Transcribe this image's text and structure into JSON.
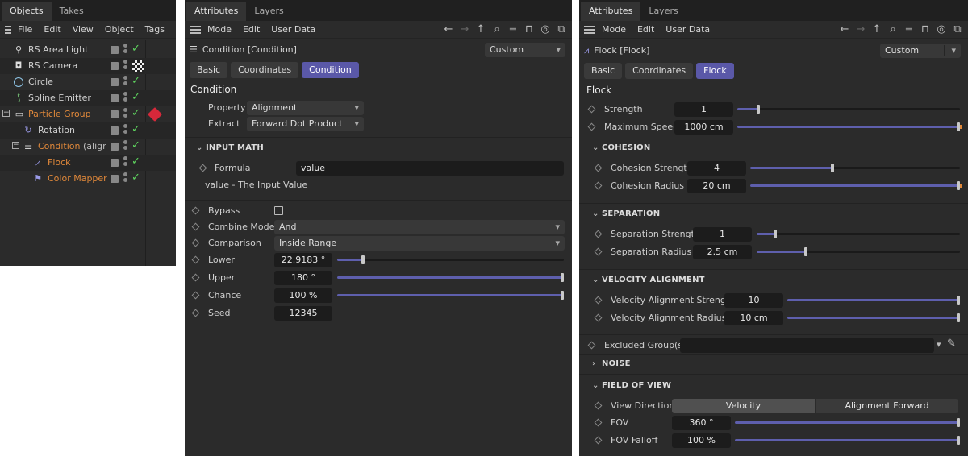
{
  "objects_panel": {
    "tabs": [
      "Objects",
      "Takes"
    ],
    "menus": [
      "File",
      "Edit",
      "View",
      "Object",
      "Tags"
    ],
    "rows": [
      {
        "name": "RS Area Light",
        "icon": "light-icon",
        "color": "normal"
      },
      {
        "name": "RS Camera",
        "icon": "camera-icon",
        "color": "normal"
      },
      {
        "name": "Circle",
        "icon": "circle-icon",
        "color": "normal"
      },
      {
        "name": "Spline Emitter",
        "icon": "spline-emitter-icon",
        "color": "normal"
      },
      {
        "name": "Particle Group",
        "icon": "folder-icon",
        "color": "orange"
      },
      {
        "name": "Rotation",
        "icon": "rotation-icon",
        "color": "normal"
      },
      {
        "name": "Condition",
        "suffix": "(align.z.",
        "icon": "condition-icon",
        "color": "orange"
      },
      {
        "name": "Flock",
        "icon": "flock-icon",
        "color": "orange"
      },
      {
        "name": "Color Mapper",
        "icon": "color-mapper-icon",
        "color": "orange"
      }
    ]
  },
  "condition_panel": {
    "tabs": [
      "Attributes",
      "Layers"
    ],
    "menus": [
      "Mode",
      "Edit",
      "User Data"
    ],
    "object_title": "Condition [Condition]",
    "preset": "Custom",
    "buttons": [
      "Basic",
      "Coordinates",
      "Condition"
    ],
    "section_title": "Condition",
    "property_label": "Property",
    "property_value": "Alignment",
    "extract_label": "Extract",
    "extract_value": "Forward Dot Product",
    "input_math_title": "INPUT MATH",
    "formula_label": "Formula",
    "formula_value": "value",
    "formula_help": "value - The Input Value",
    "bypass_label": "Bypass",
    "combine_mode_label": "Combine Mode",
    "combine_mode_value": "And",
    "comparison_label": "Comparison",
    "comparison_value": "Inside Range",
    "lower_label": "Lower",
    "lower_value": "22.9183 °",
    "lower_level": 0.12,
    "upper_label": "Upper",
    "upper_value": "180 °",
    "upper_level": 1.0,
    "chance_label": "Chance",
    "chance_value": "100 %",
    "chance_level": 1.0,
    "seed_label": "Seed",
    "seed_value": "12345"
  },
  "flock_panel": {
    "tabs": [
      "Attributes",
      "Layers"
    ],
    "menus": [
      "Mode",
      "Edit",
      "User Data"
    ],
    "object_title": "Flock [Flock]",
    "preset": "Custom",
    "buttons": [
      "Basic",
      "Coordinates",
      "Flock"
    ],
    "section_title": "Flock",
    "strength_label": "Strength",
    "strength_value": "1",
    "strength_level": 0.1,
    "max_speed_label": "Maximum Speed",
    "max_speed_value": "1000 cm",
    "max_speed_level": 1.0,
    "cohesion_title": "COHESION",
    "cohesion_strength_label": "Cohesion Strength",
    "cohesion_strength_value": "4",
    "cohesion_strength_level": 0.4,
    "cohesion_radius_label": "Cohesion Radius",
    "cohesion_radius_value": "20 cm",
    "cohesion_radius_level": 1.0,
    "separation_title": "SEPARATION",
    "separation_strength_label": "Separation Strength",
    "separation_strength_value": "1",
    "separation_strength_level": 0.1,
    "separation_radius_label": "Separation Radius",
    "separation_radius_value": "2.5 cm",
    "separation_radius_level": 0.25,
    "velocity_title": "VELOCITY ALIGNMENT",
    "vel_strength_label": "Velocity Alignment Strength",
    "vel_strength_value": "10",
    "vel_strength_level": 1.0,
    "vel_radius_label": "Velocity Alignment Radius",
    "vel_radius_value": "10 cm",
    "vel_radius_level": 1.0,
    "excluded_label": "Excluded Group(s)",
    "noise_title": "NOISE",
    "fov_title": "FIELD OF VIEW",
    "view_direction_label": "View Direction",
    "view_direction_options": [
      "Velocity",
      "Alignment Forward"
    ],
    "fov_label": "FOV",
    "fov_value": "360 °",
    "fov_level": 1.0,
    "fov_falloff_label": "FOV Falloff",
    "fov_falloff_value": "100 %",
    "fov_falloff_level": 1.0
  },
  "colors": {
    "accent": "#5a58a8",
    "slider": "#5e5fad",
    "orange": "#e0883a",
    "check": "#5ed35e"
  }
}
